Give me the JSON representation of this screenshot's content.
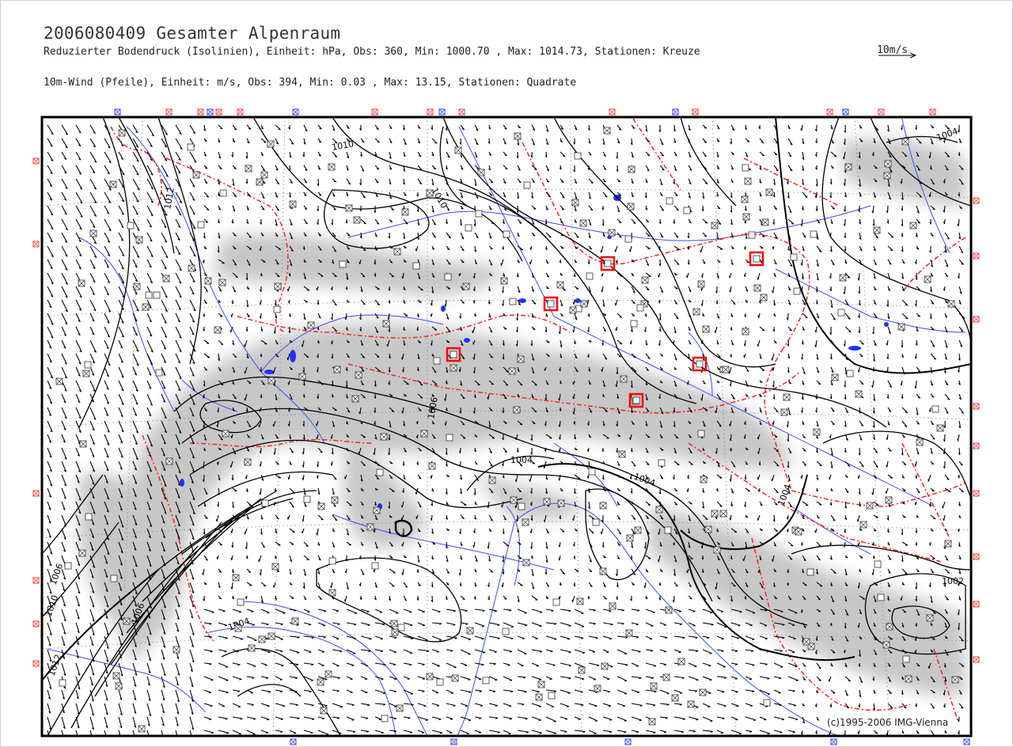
{
  "header": {
    "title": "2006080409 Gesamter Alpenraum",
    "line1": "Reduzierter Bodendruck (Isolinien), Einheit: hPa, Obs:  360, Min: 1000.70 , Max: 1014.73, Stationen: Kreuze",
    "line2": "10m-Wind (Pfeile), Einheit: m/s, Obs:  394, Min:   0.03 , Max:  13.15, Stationen: Quadrate"
  },
  "scale": {
    "label": "10m/s"
  },
  "isobar_labels": [
    "1010",
    "1012",
    "1010",
    "1004",
    "1006",
    "1004",
    "1004",
    "1002",
    "1004",
    "1006",
    "1010",
    "1012",
    "1006",
    "1004"
  ],
  "highlighted_stations_count": 6,
  "copyright": "(c)1995-2006 IMG-Vienna",
  "colors": {
    "frame": "#000000",
    "isobar": "#000000",
    "river": "#3b4bff",
    "border": "#ff2020",
    "terrain": "#8a8a8a",
    "highlight": "#ff0000"
  }
}
